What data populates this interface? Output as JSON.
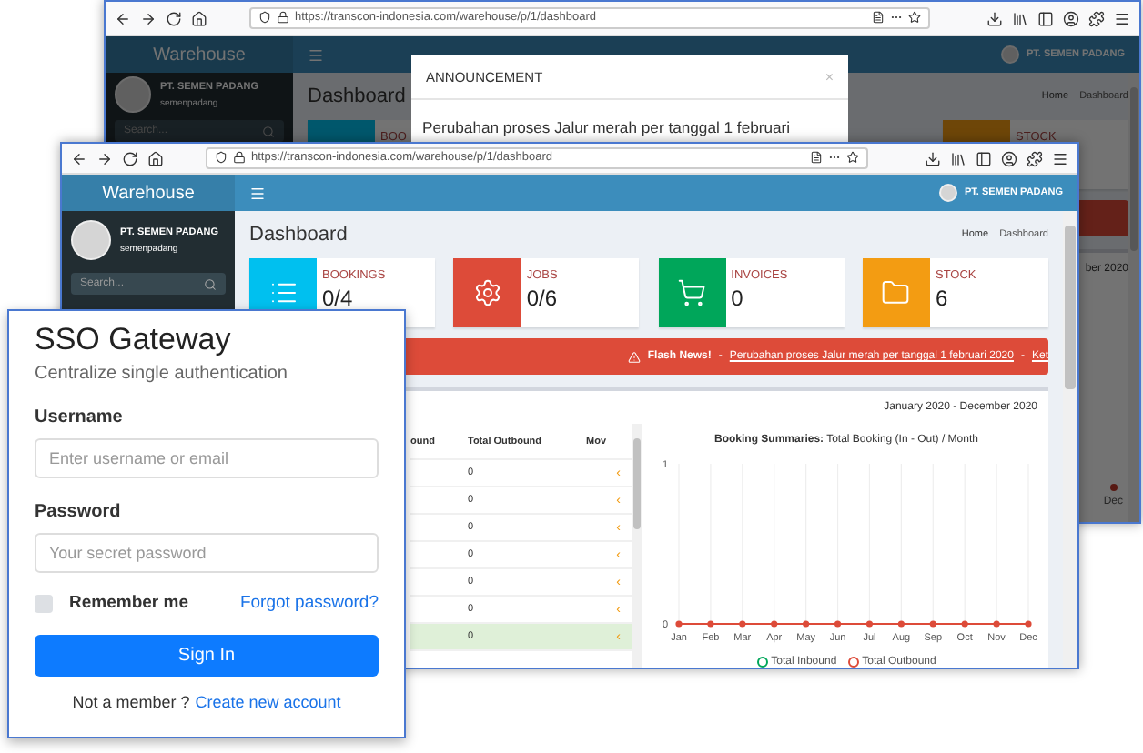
{
  "back_window": {
    "url": "https://transcon-indonesia.com/warehouse/p/1/dashboard",
    "brand": "Warehouse",
    "header_user": "PT. SEMEN PADANG",
    "user_name": "PT. SEMEN PADANG",
    "user_login": "semenpadang",
    "search_placeholder": "Search...",
    "page_title": "Dashboard",
    "breadcrumb": [
      "Home",
      "Dashboard"
    ],
    "boxes": [
      {
        "label": "BOO"
      },
      {
        "label": "STOCK"
      }
    ],
    "date_range": "ber 2020",
    "last_month": "Dec",
    "modal": {
      "title": "ANNOUNCEMENT",
      "close": "×",
      "message": "Perubahan proses Jalur merah per tanggal 1 februari"
    }
  },
  "front_window": {
    "url": "https://transcon-indonesia.com/warehouse/p/1/dashboard",
    "brand": "Warehouse",
    "header_user": "PT. SEMEN PADANG",
    "user_name": "PT. SEMEN PADANG",
    "user_login": "semenpadang",
    "search_placeholder": "Search...",
    "page_title": "Dashboard",
    "breadcrumb": [
      "Home",
      "Dashboard"
    ],
    "boxes": [
      {
        "label": "BOOKINGS",
        "value": "0/4",
        "color": "#00c0ef"
      },
      {
        "label": "JOBS",
        "value": "0/6",
        "color": "#dd4b39"
      },
      {
        "label": "INVOICES",
        "value": "0",
        "color": "#00a65a"
      },
      {
        "label": "STOCK",
        "value": "6",
        "color": "#f39c12"
      }
    ],
    "flash": {
      "title": "Flash News!",
      "separator": "-",
      "link": "Perubahan proses Jalur merah per tanggal 1 februari 2020",
      "separator_2": "-",
      "next": "Ket"
    },
    "date_range": "January 2020 - December 2020",
    "table": {
      "columns": [
        "ound",
        "Total Outbound",
        "Mov"
      ],
      "rows": [
        {
          "outbound": "0",
          "action": "‹",
          "selected": false
        },
        {
          "outbound": "0",
          "action": "‹",
          "selected": false
        },
        {
          "outbound": "0",
          "action": "‹",
          "selected": false
        },
        {
          "outbound": "0",
          "action": "‹",
          "selected": false
        },
        {
          "outbound": "0",
          "action": "‹",
          "selected": false
        },
        {
          "outbound": "0",
          "action": "‹",
          "selected": false
        },
        {
          "outbound": "0",
          "action": "‹",
          "selected": true
        }
      ]
    },
    "chart_data": {
      "type": "line",
      "title": "**Booking Summaries:** Total Booking (In - Out) / Month",
      "categories": [
        "Jan",
        "Feb",
        "Mar",
        "Apr",
        "May",
        "Jun",
        "Jul",
        "Aug",
        "Sep",
        "Oct",
        "Nov",
        "Dec"
      ],
      "series": [
        {
          "name": "Total Inbound",
          "color": "#00a65a",
          "marker": "circle",
          "values": [
            null,
            null,
            null,
            null,
            null,
            null,
            null,
            null,
            null,
            null,
            null,
            null
          ]
        },
        {
          "name": "Total Outbound",
          "color": "#dd4b39",
          "marker": "circle",
          "values": [
            0,
            0,
            0,
            0,
            0,
            0,
            0,
            0,
            0,
            0,
            0,
            0
          ]
        }
      ],
      "ylim": [
        0,
        1
      ],
      "yticks": [
        0,
        1
      ],
      "grid": true,
      "legend": true
    }
  },
  "login": {
    "title": "SSO Gateway",
    "subtitle": "Centralize single authentication",
    "username_label": "Username",
    "username_placeholder": "Enter username or email",
    "password_label": "Password",
    "password_placeholder": "Your secret password",
    "remember": {
      "label": "Remember me",
      "checked": false
    },
    "forgot": "Forgot password?",
    "submit": "Sign In",
    "signup_prompt": "Not a member ?",
    "signup_link": "Create new account"
  }
}
